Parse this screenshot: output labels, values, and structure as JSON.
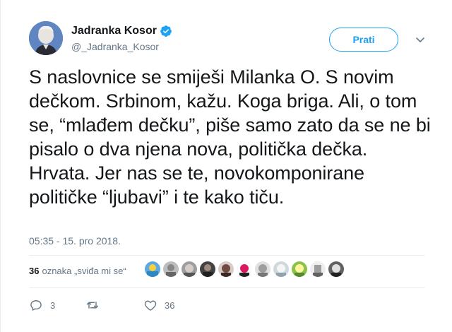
{
  "author": {
    "name": "Jadranka Kosor",
    "handle": "@_Jadranka_Kosor",
    "avatar_icon": "profile-photo"
  },
  "follow_button_label": "Prati",
  "tweet_text": "S naslovnice se smiješi Milanka O. S novim dečkom. Srbinom, kažu. Koga briga. Ali, o tom se, “mlađem dečku”, piše samo zato da se ne bi pisalo o dva njena nova, politička dečka. Hrvata. Jer nas se te, novokomponirane političke “ljubavi” i te kako tiču.",
  "timestamp": "05:35 - 15. pro 2018.",
  "likes": {
    "count": "36",
    "label": "oznaka „sviđa mi se“"
  },
  "actions": {
    "replies": "3",
    "retweets": "",
    "likes": "36"
  },
  "colors": {
    "accent": "#1da1f2",
    "muted": "#657786",
    "text": "#14171a",
    "divider": "#e6ecf0"
  }
}
